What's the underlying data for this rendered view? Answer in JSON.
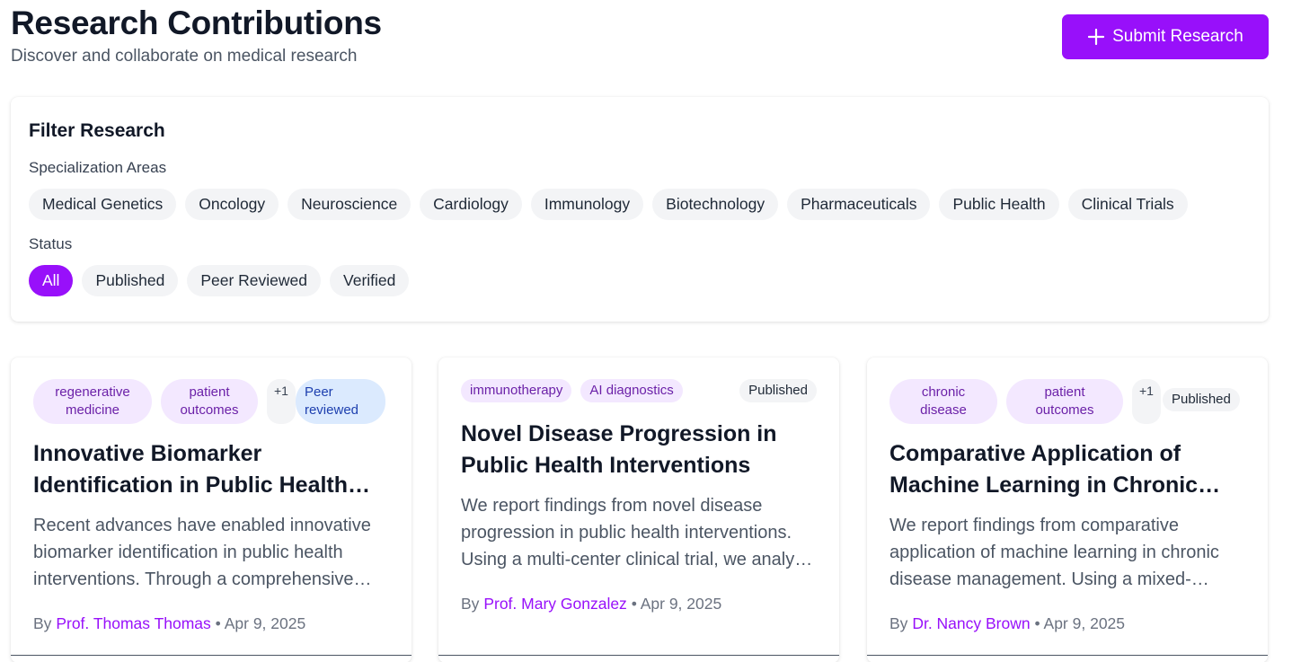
{
  "header": {
    "title": "Research Contributions",
    "subtitle": "Discover and collaborate on medical research",
    "submit_label": "Submit Research",
    "submit_icon": "plus-icon"
  },
  "colors": {
    "accent": "#9810fa",
    "tag_bg": "#f3e8ff",
    "peer_bg": "#dbeafe"
  },
  "filters": {
    "title": "Filter Research",
    "specialization_label": "Specialization Areas",
    "specializations": [
      "Medical Genetics",
      "Oncology",
      "Neuroscience",
      "Cardiology",
      "Immunology",
      "Biotechnology",
      "Pharmaceuticals",
      "Public Health",
      "Clinical Trials"
    ],
    "status_label": "Status",
    "statuses": [
      "All",
      "Published",
      "Peer Reviewed",
      "Verified"
    ],
    "active_status": "All"
  },
  "cards": [
    {
      "tags": [
        "regenerative medicine",
        "patient outcomes"
      ],
      "more": "+1",
      "status": "Peer reviewed",
      "title": "Innovative Biomarker Identification in Public Health Interventions",
      "description": "Recent advances have enabled innovative biomarker identification in public health interventions. Through a comprehensive study design, we examine outcomes.",
      "by": "By",
      "author": "Prof. Thomas Thomas",
      "separator": "•",
      "date": "Apr 9, 2025"
    },
    {
      "tags": [
        "immunotherapy",
        "AI diagnostics"
      ],
      "more": "",
      "status": "Published",
      "title": "Novel Disease Progression in Public Health Interventions",
      "description": "We report findings from novel disease progression in public health interventions. Using a multi-center clinical trial, we analyze results.",
      "by": "By",
      "author": "Prof. Mary Gonzalez",
      "separator": "•",
      "date": "Apr 9, 2025"
    },
    {
      "tags": [
        "chronic disease",
        "patient outcomes"
      ],
      "more": "+1",
      "status": "Published",
      "title": "Comparative Application of Machine Learning in Chronic Disease Management",
      "description": "We report findings from comparative application of machine learning in chronic disease management. Using a mixed-methods approach, we evaluate.",
      "by": "By",
      "author": "Dr. Nancy Brown",
      "separator": "•",
      "date": "Apr 9, 2025"
    }
  ]
}
